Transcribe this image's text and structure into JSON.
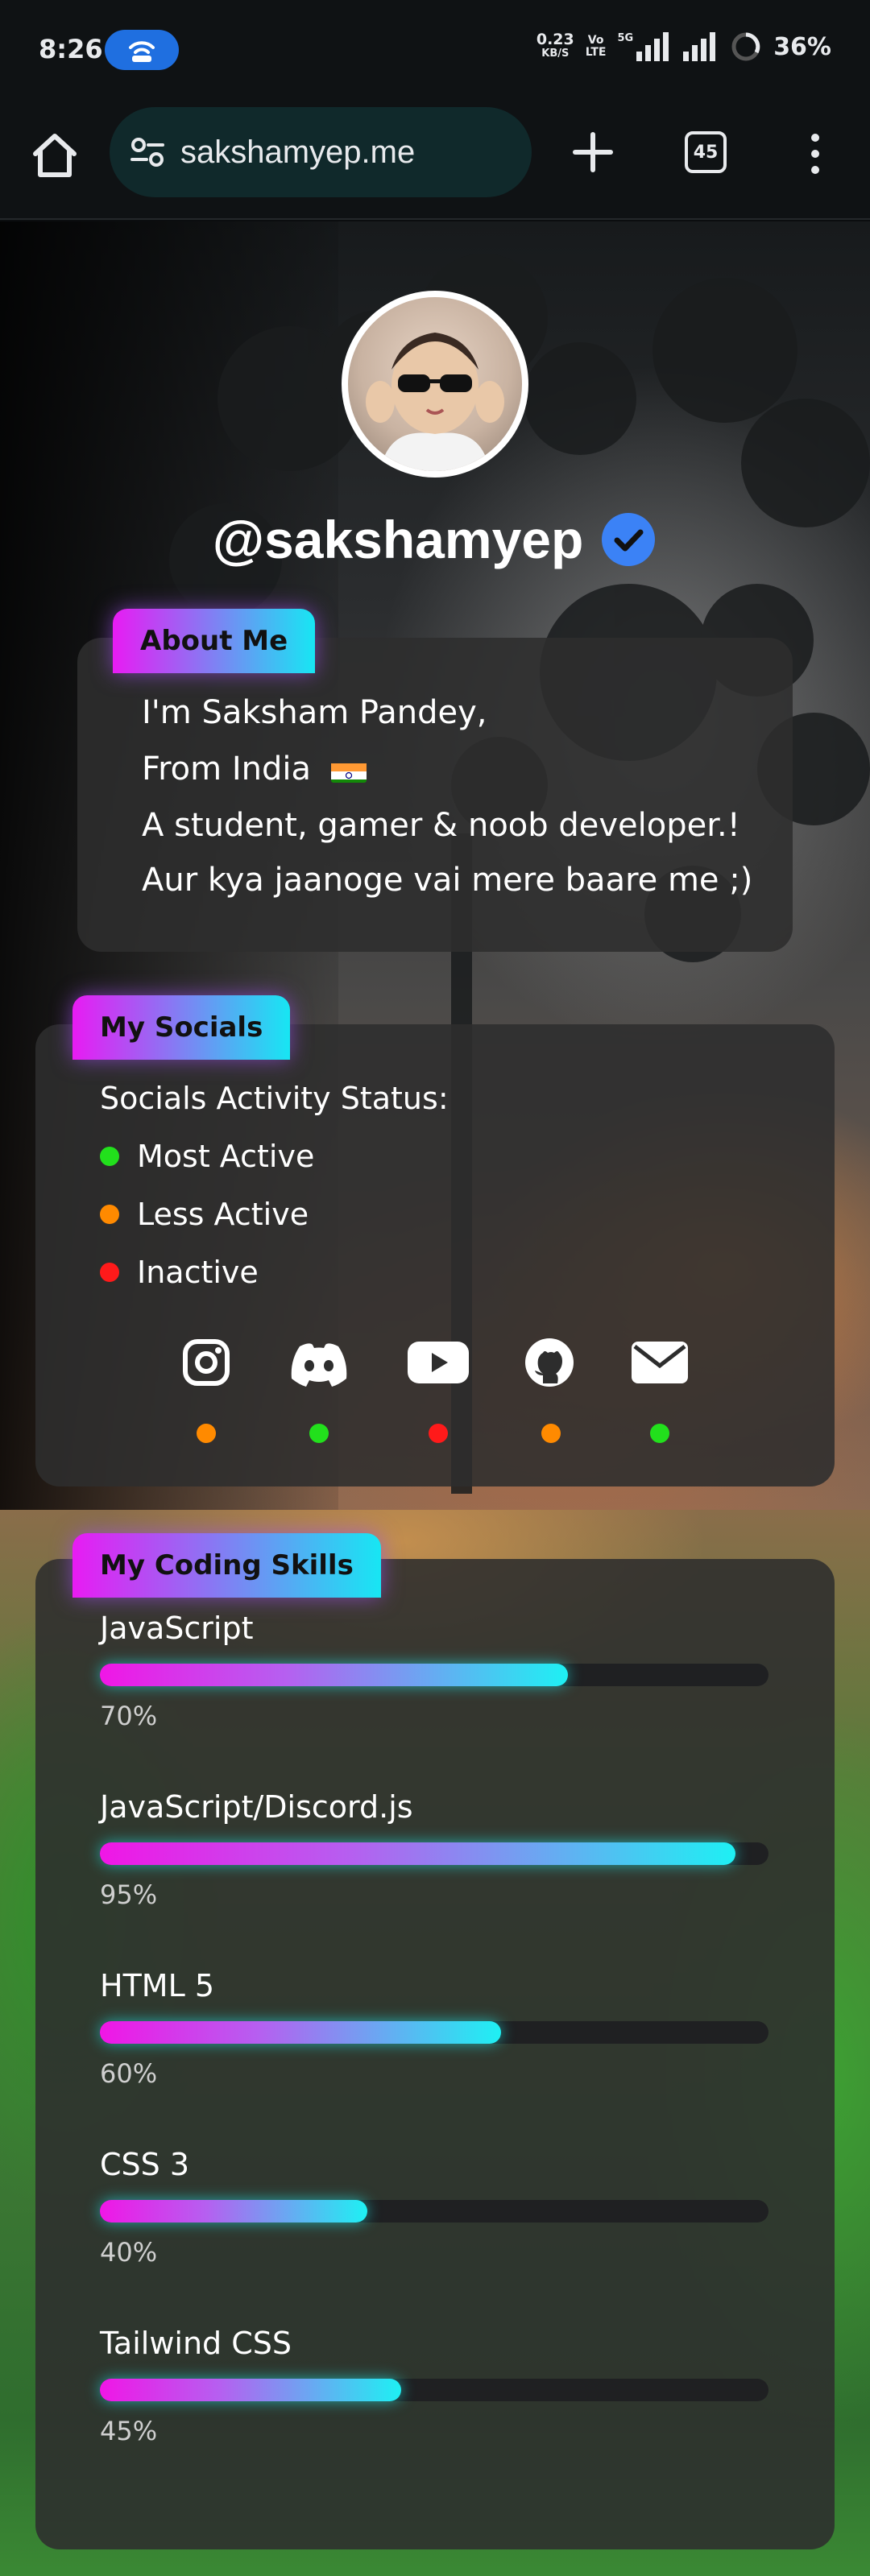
{
  "status_bar": {
    "time": "8:26",
    "net_speed": "0.23",
    "net_unit": "KB/S",
    "volte_top": "Vo",
    "volte_bottom": "LTE",
    "network": "5G",
    "battery": "36%"
  },
  "browser": {
    "url": "sakshamyep.me",
    "tab_count": "45",
    "icons": [
      "home-icon",
      "site-settings-icon",
      "new-tab-icon",
      "tab-switcher-icon",
      "more-menu-icon"
    ]
  },
  "profile": {
    "username": "@sakshamyep",
    "verified_color": "#3b82f6"
  },
  "about": {
    "tag": "About Me",
    "lines": [
      "I'm Saksham Pandey,",
      "From India",
      "A student, gamer & noob developer.!",
      "Aur kya jaanoge vai mere baare me ;)"
    ]
  },
  "socials": {
    "tag": "My Socials",
    "status_title": "Socials Activity Status:",
    "legend": [
      {
        "label": "Most Active",
        "color": "#22e01c"
      },
      {
        "label": "Less Active",
        "color": "#ff8a00"
      },
      {
        "label": "Inactive",
        "color": "#ff1a1a"
      }
    ],
    "links": [
      {
        "icon": "instagram-icon",
        "status": "Less Active",
        "color": "#ff8a00"
      },
      {
        "icon": "discord-icon",
        "status": "Most Active",
        "color": "#22e01c"
      },
      {
        "icon": "youtube-icon",
        "status": "Inactive",
        "color": "#ff1a1a"
      },
      {
        "icon": "github-icon",
        "status": "Less Active",
        "color": "#ff8a00"
      },
      {
        "icon": "email-icon",
        "status": "Most Active",
        "color": "#22e01c"
      }
    ]
  },
  "skills": {
    "tag": "My Coding Skills",
    "items": [
      {
        "name": "JavaScript",
        "value": 70,
        "label": "70%"
      },
      {
        "name": "JavaScript/Discord.js",
        "value": 95,
        "label": "95%"
      },
      {
        "name": "HTML 5",
        "value": 60,
        "label": "60%"
      },
      {
        "name": "CSS 3",
        "value": 40,
        "label": "40%"
      },
      {
        "name": "Tailwind CSS",
        "value": 45,
        "label": "45%"
      }
    ],
    "accent_start": "#f016e6",
    "accent_end": "#1ef0f3"
  }
}
